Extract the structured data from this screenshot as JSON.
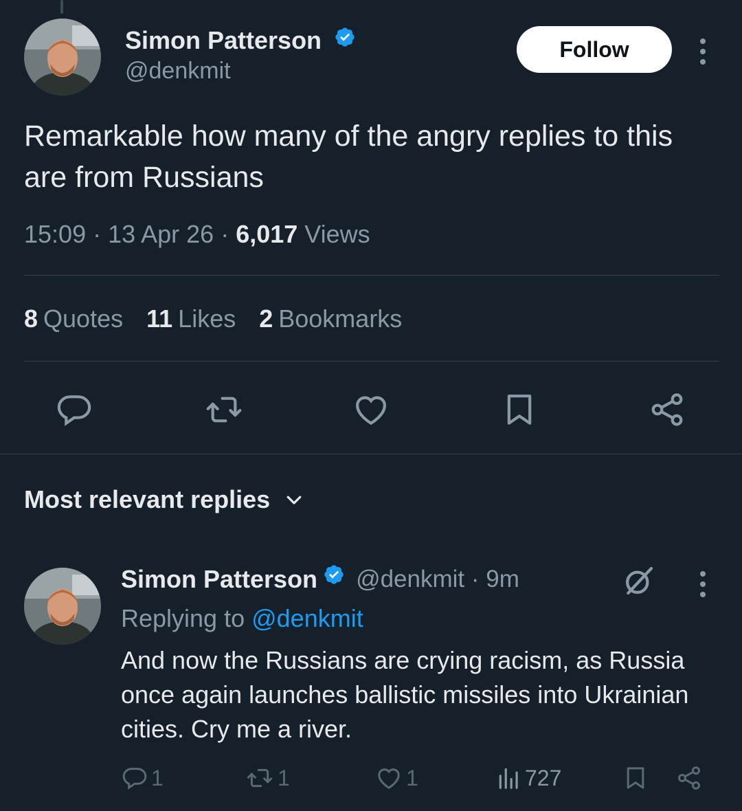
{
  "tweet": {
    "author_name": "Simon Patterson",
    "author_handle": "@denkmit",
    "follow_label": "Follow",
    "text": "Remarkable how many of the angry replies to this are from Russians",
    "time": "15:09 · 13 Apr 26 · ",
    "views_count": "6,017",
    "views_label": " Views",
    "stats": {
      "quotes_count": "8",
      "quotes_label": "Quotes",
      "likes_count": "11",
      "likes_label": "Likes",
      "bookmarks_count": "2",
      "bookmarks_label": "Bookmarks"
    },
    "icons": [
      "reply-icon",
      "retweet-icon",
      "like-icon",
      "bookmark-icon",
      "share-icon"
    ]
  },
  "replies_section": {
    "title": "Most relevant replies"
  },
  "reply": {
    "author_name": "Simon Patterson",
    "handle_time": "@denkmit · 9m",
    "replying_prefix": "Replying to ",
    "replying_handle": "@denkmit",
    "text": "And now the Russians are crying racism, as Russia once again launches ballistic missiles into Ukrainian cities. Cry me a river.",
    "actions": {
      "replies": "1",
      "retweets": "1",
      "likes": "1",
      "views": "727"
    }
  },
  "colors": {
    "background": "#15202b",
    "accent": "#1d9bf0",
    "text_primary": "#e7e9ea",
    "text_secondary": "#8b98a5"
  }
}
